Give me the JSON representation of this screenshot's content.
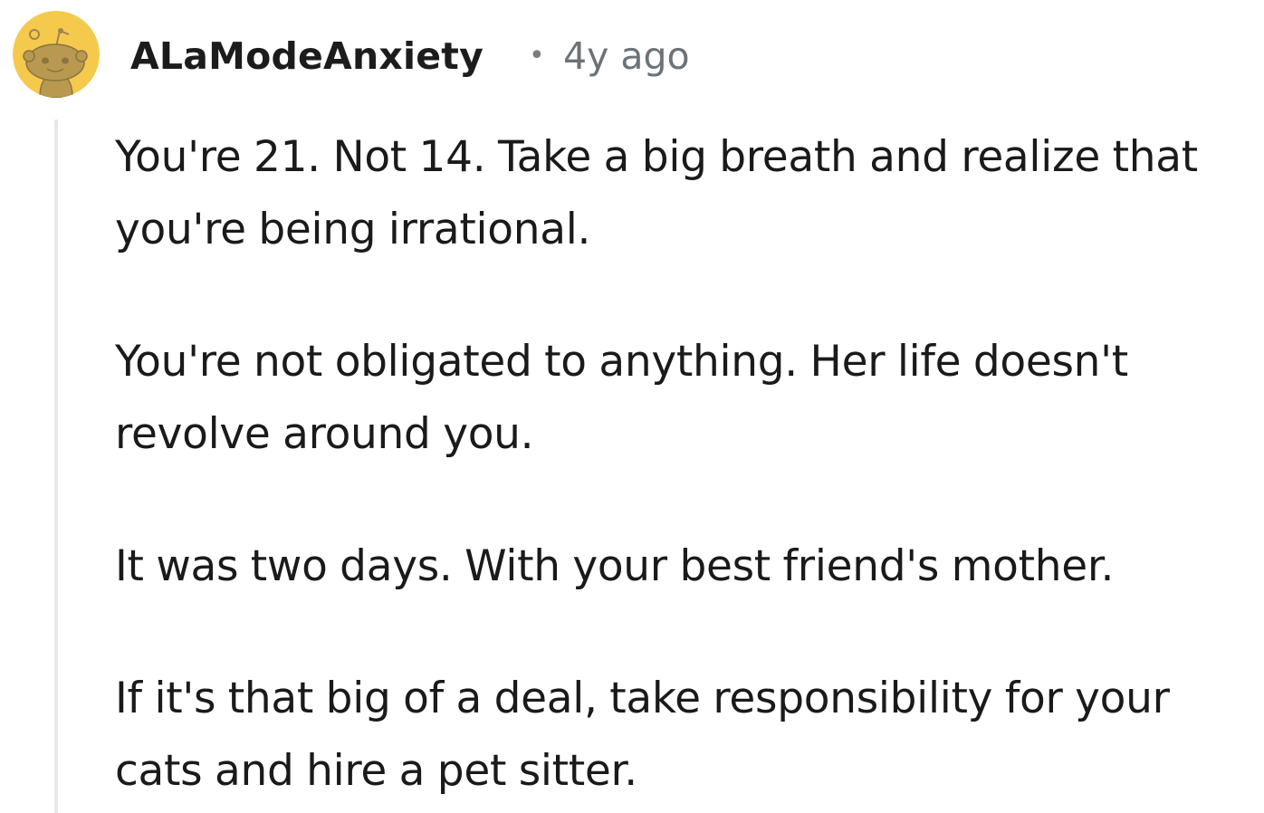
{
  "comment": {
    "author": "ALaModeAnxiety",
    "separator": "•",
    "timestamp": "4y ago",
    "avatar_icon": "reddit-snoo-avatar-icon",
    "colors": {
      "avatar_background": "#F5C94B",
      "thread_line": "#E6E8EA",
      "timestamp": "#6A7378"
    },
    "paragraphs": [
      "You're 21. Not 14. Take a big breath and realize that you're being irrational.",
      "You're not obligated to anything. Her life doesn't revolve around you.",
      "It was two days. With your best friend's mother.",
      "If it's that big of a deal, take responsibility for your cats and hire a pet sitter."
    ]
  }
}
